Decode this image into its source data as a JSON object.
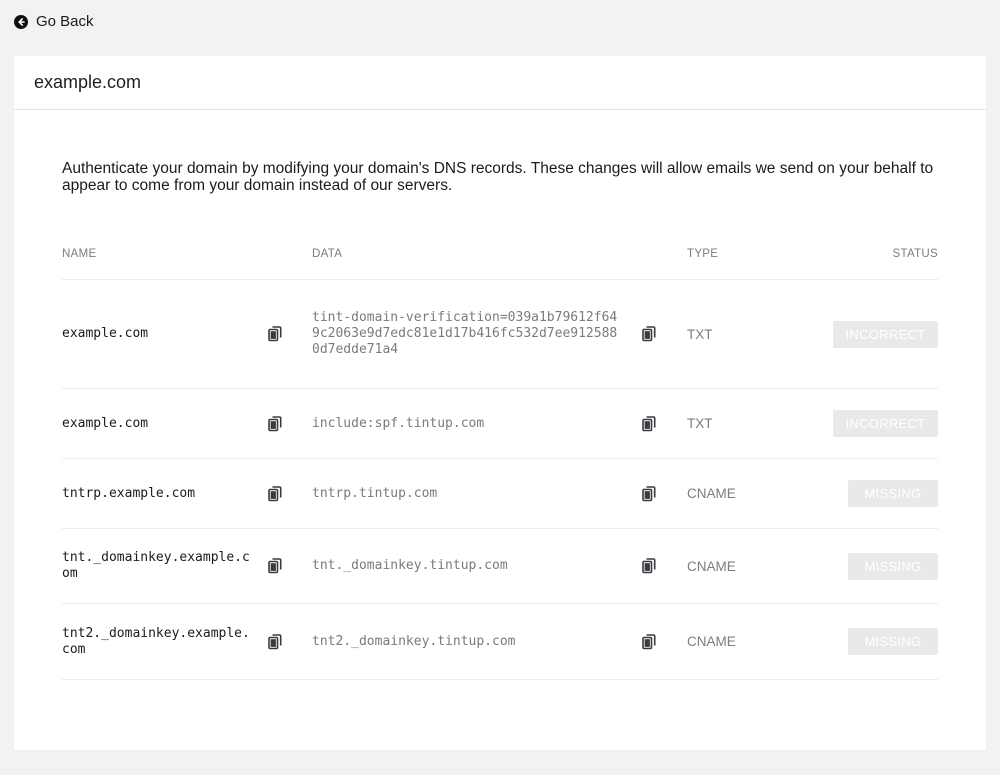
{
  "nav": {
    "go_back_label": "Go Back"
  },
  "card": {
    "title": "example.com",
    "intro": "Authenticate your domain by modifying your domain's DNS records. These changes will allow emails we send on your behalf to appear to come from your domain instead of our servers."
  },
  "table": {
    "headers": {
      "name": "NAME",
      "data": "DATA",
      "type": "TYPE",
      "status": "STATUS"
    },
    "rows": [
      {
        "name": "example.com",
        "data": "tint-domain-verification=039a1b79612f649c2063e9d7edc81e1d17b416fc532d7ee9125880d7edde71a4",
        "type": "TXT",
        "status": "INCORRECT"
      },
      {
        "name": "example.com",
        "data": "include:spf.tintup.com",
        "type": "TXT",
        "status": "INCORRECT"
      },
      {
        "name": "tntrp.example.com",
        "data": "tntrp.tintup.com",
        "type": "CNAME",
        "status": "MISSING"
      },
      {
        "name": "tnt._domainkey.example.com",
        "data": "tnt._domainkey.tintup.com",
        "type": "CNAME",
        "status": "MISSING"
      },
      {
        "name": "tnt2._domainkey.example.com",
        "data": "tnt2._domainkey.tintup.com",
        "type": "CNAME",
        "status": "MISSING"
      }
    ]
  },
  "icons": {
    "back": "arrow-left-circle-icon",
    "copy": "copy-icon"
  },
  "colors": {
    "badge_bg": "#e9e9eb",
    "badge_text": "#ffffff",
    "muted_text": "#7b7b82"
  }
}
